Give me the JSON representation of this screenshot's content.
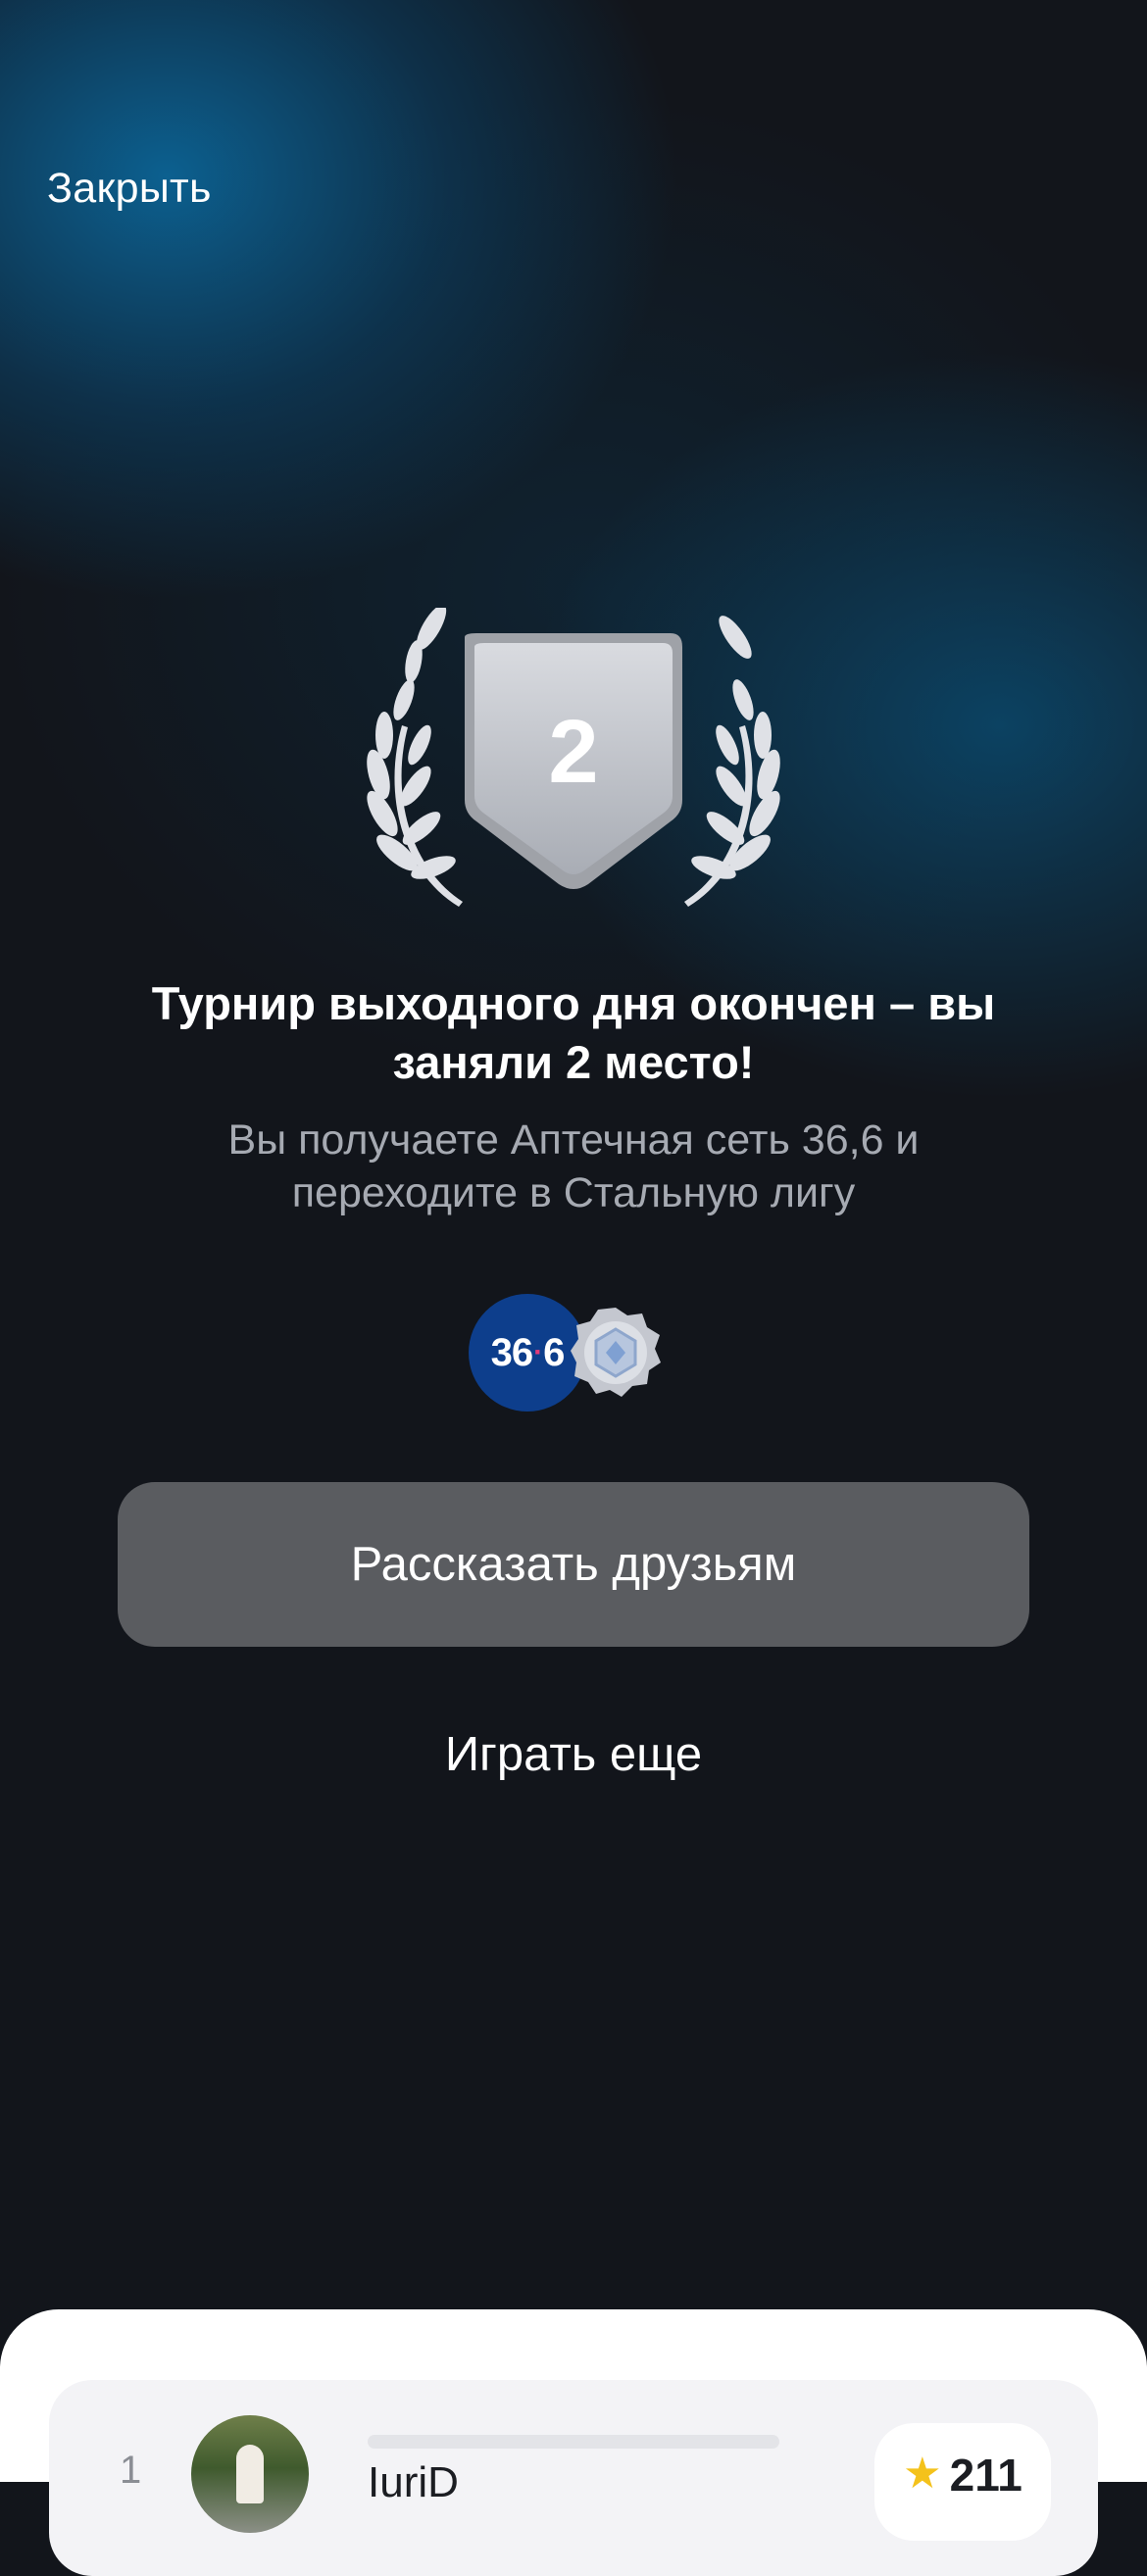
{
  "header": {
    "close_label": "Закрыть"
  },
  "trophy": {
    "place": "2",
    "icon": "laurel-shield-icon",
    "color": "#c0c3ca"
  },
  "result": {
    "title": "Турнир выходного дня окончен – вы заняли 2 место!",
    "subtitle": "Вы получаете Аптечная сеть 36,6 и переходите в Стальную лигу"
  },
  "rewards": {
    "pharmacy_logo_main": "36",
    "pharmacy_logo_dot": "·",
    "pharmacy_logo_tail": "6",
    "league_icon": "steel-league-badge-icon",
    "brand_color": "#0d3e8c"
  },
  "actions": {
    "share_label": "Рассказать друзьям",
    "play_again_label": "Играть еще"
  },
  "leaderboard": {
    "rows": [
      {
        "rank": "1",
        "name": "IuriD",
        "score": "211",
        "score_icon": "star-icon"
      }
    ]
  }
}
